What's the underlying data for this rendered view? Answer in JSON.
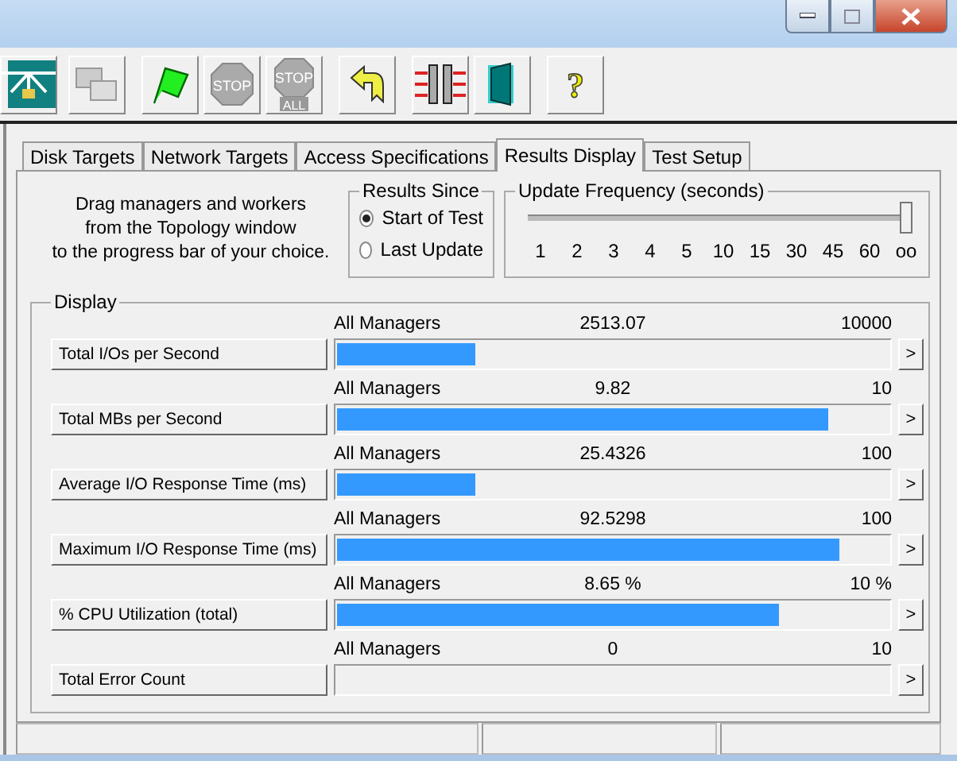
{
  "toolbar": [
    {
      "kind": "topology",
      "disabled": false
    },
    {
      "kind": "workers",
      "disabled": true
    },
    {
      "kind": "start",
      "disabled": false
    },
    {
      "kind": "stop",
      "disabled": true,
      "label": "STOP"
    },
    {
      "kind": "stopall",
      "disabled": true,
      "label": "STOP",
      "sublabel": "ALL"
    },
    {
      "kind": "reset",
      "disabled": false
    },
    {
      "kind": "connect",
      "disabled": false
    },
    {
      "kind": "exit",
      "disabled": false
    },
    {
      "kind": "help",
      "disabled": false,
      "label": "?"
    }
  ],
  "tabs": [
    {
      "label": "Disk Targets",
      "selected": false
    },
    {
      "label": "Network Targets",
      "selected": false
    },
    {
      "label": "Access Specifications",
      "selected": false
    },
    {
      "label": "Results Display",
      "selected": true
    },
    {
      "label": "Test Setup",
      "selected": false
    }
  ],
  "instructions": [
    "Drag managers and workers",
    "from the Topology window",
    "to the progress bar of your choice."
  ],
  "results_since": {
    "title": "Results Since",
    "options": [
      {
        "label": "Start of Test",
        "selected": true
      },
      {
        "label": "Last Update",
        "selected": false
      }
    ]
  },
  "update_frequency": {
    "title": "Update Frequency (seconds)",
    "level": 1,
    "ticks": [
      "1",
      "2",
      "3",
      "4",
      "5",
      "10",
      "15",
      "30",
      "45",
      "60",
      "oo"
    ]
  },
  "display": {
    "title": "Display",
    "metrics": [
      {
        "label": "Total I/Os per Second",
        "source": "All Managers",
        "value": "2513.07",
        "max": "10000",
        "level": 0.25
      },
      {
        "label": "Total MBs per Second",
        "source": "All Managers",
        "value": "9.82",
        "max": "10",
        "level": 0.89
      },
      {
        "label": "Average I/O Response Time (ms)",
        "source": "All Managers",
        "value": "25.4326",
        "max": "100",
        "level": 0.25
      },
      {
        "label": "Maximum I/O Response Time (ms)",
        "source": "All Managers",
        "value": "92.5298",
        "max": "100",
        "level": 0.91
      },
      {
        "label": "% CPU Utilization (total)",
        "source": "All Managers",
        "value": "8.65 %",
        "max": "10 %",
        "level": 0.8
      },
      {
        "label": "Total Error Count",
        "source": "All Managers",
        "value": "0",
        "max": "10",
        "level": 0
      }
    ],
    "arrow": ">"
  }
}
